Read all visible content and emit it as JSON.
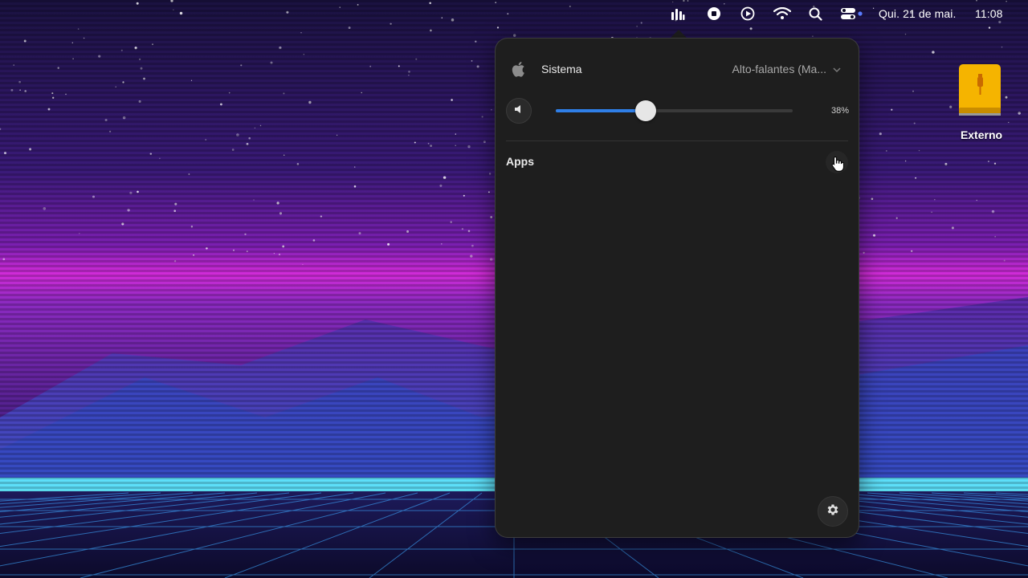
{
  "menubar": {
    "icons": [
      "audio-mixer-icon",
      "media-icon",
      "play-circle-icon",
      "wifi-icon",
      "search-icon",
      "control-center-icon"
    ],
    "clock_date": "Qui. 21 de mai.",
    "clock_time": "11:08"
  },
  "popover": {
    "device_icon": "apple-icon",
    "device_title": "Sistema",
    "output_device": "Alto-falantes (Ma...",
    "volume_icon": "speaker-icon",
    "volume_level": 0.38,
    "volume_percent_label": "38%",
    "apps_label": "Apps",
    "settings_icon": "gear-icon"
  },
  "desktop": {
    "drive_label": "Externo",
    "drive_icon": "external-drive-icon"
  },
  "colors": {
    "popover_bg": "#1e1e1e",
    "accent": "#2f7fe8",
    "drive": "#f5b400"
  }
}
